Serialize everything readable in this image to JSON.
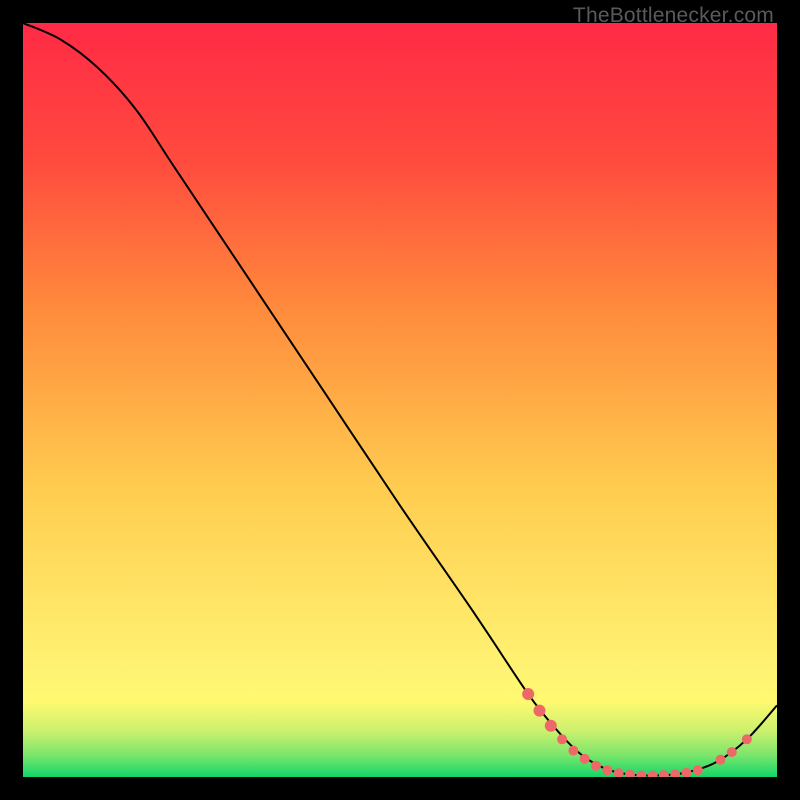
{
  "watermark": "TheBottlenecker.com",
  "chart_data": {
    "type": "line",
    "title": "",
    "xlabel": "",
    "ylabel": "",
    "xlim": [
      0,
      100
    ],
    "ylim": [
      0,
      100
    ],
    "gradient_stops": [
      {
        "pos": 0.0,
        "color": "#12d66a"
      },
      {
        "pos": 0.03,
        "color": "#7ee66b"
      },
      {
        "pos": 0.06,
        "color": "#c9f06e"
      },
      {
        "pos": 0.1,
        "color": "#fff970"
      },
      {
        "pos": 0.14,
        "color": "#fff373"
      },
      {
        "pos": 0.38,
        "color": "#ffcd50"
      },
      {
        "pos": 0.62,
        "color": "#ff8b3c"
      },
      {
        "pos": 0.82,
        "color": "#ff4a3e"
      },
      {
        "pos": 1.0,
        "color": "#ff2a46"
      }
    ],
    "curve": [
      {
        "x": 0.0,
        "y": 100.0
      },
      {
        "x": 5.0,
        "y": 97.8
      },
      {
        "x": 10.0,
        "y": 94.0
      },
      {
        "x": 15.0,
        "y": 88.5
      },
      {
        "x": 20.0,
        "y": 81.0
      },
      {
        "x": 30.0,
        "y": 66.0
      },
      {
        "x": 40.0,
        "y": 51.0
      },
      {
        "x": 50.0,
        "y": 36.0
      },
      {
        "x": 60.0,
        "y": 21.5
      },
      {
        "x": 67.0,
        "y": 11.0
      },
      {
        "x": 71.0,
        "y": 6.0
      },
      {
        "x": 74.0,
        "y": 3.0
      },
      {
        "x": 77.0,
        "y": 1.2
      },
      {
        "x": 80.0,
        "y": 0.4
      },
      {
        "x": 84.0,
        "y": 0.2
      },
      {
        "x": 88.0,
        "y": 0.6
      },
      {
        "x": 92.0,
        "y": 2.0
      },
      {
        "x": 96.0,
        "y": 5.0
      },
      {
        "x": 100.0,
        "y": 9.5
      }
    ],
    "markers": [
      {
        "x": 67.0,
        "y": 11.0,
        "r": 6
      },
      {
        "x": 68.5,
        "y": 8.8,
        "r": 6
      },
      {
        "x": 70.0,
        "y": 6.8,
        "r": 6
      },
      {
        "x": 71.5,
        "y": 5.0,
        "r": 5
      },
      {
        "x": 73.0,
        "y": 3.5,
        "r": 5
      },
      {
        "x": 74.5,
        "y": 2.4,
        "r": 5
      },
      {
        "x": 76.0,
        "y": 1.5,
        "r": 5
      },
      {
        "x": 77.5,
        "y": 0.9,
        "r": 5
      },
      {
        "x": 79.0,
        "y": 0.5,
        "r": 5
      },
      {
        "x": 80.5,
        "y": 0.3,
        "r": 5
      },
      {
        "x": 82.0,
        "y": 0.2,
        "r": 5
      },
      {
        "x": 83.5,
        "y": 0.2,
        "r": 5
      },
      {
        "x": 85.0,
        "y": 0.25,
        "r": 5
      },
      {
        "x": 86.5,
        "y": 0.35,
        "r": 5
      },
      {
        "x": 88.0,
        "y": 0.55,
        "r": 5
      },
      {
        "x": 89.5,
        "y": 0.9,
        "r": 5
      },
      {
        "x": 92.5,
        "y": 2.3,
        "r": 5
      },
      {
        "x": 94.0,
        "y": 3.3,
        "r": 5
      },
      {
        "x": 96.0,
        "y": 5.0,
        "r": 5
      }
    ],
    "marker_color": "#ee6868",
    "line_color": "#000000",
    "line_width": 2
  }
}
